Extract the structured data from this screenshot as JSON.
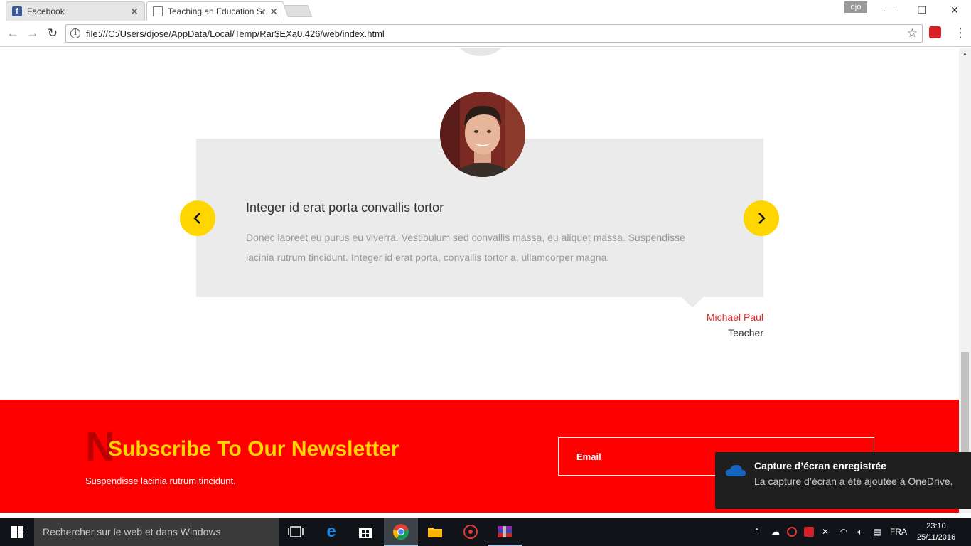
{
  "browser": {
    "tabs": [
      {
        "title": "Facebook",
        "icon": "facebook-icon"
      },
      {
        "title": "Teaching an Education Sc",
        "icon": "document-icon"
      }
    ],
    "profile_label": "djo",
    "url": "file:///C:/Users/djose/AppData/Local/Temp/Rar$EXa0.426/web/index.html"
  },
  "testimonial": {
    "heading": "Integer id erat porta convallis tortor",
    "body": "Donec laoreet eu purus eu viverra. Vestibulum sed convallis massa, eu aliquet massa. Suspendisse lacinia rutrum tincidunt. Integer id erat porta, convallis tortor a, ullamcorper magna.",
    "author_name": "Michael Paul",
    "author_role": "Teacher"
  },
  "newsletter": {
    "big_letter": "N",
    "title": "Subscribe To Our Newsletter",
    "subtitle": "Suspendisse lacinia rutrum tincidunt.",
    "email_placeholder": "Email"
  },
  "toast": {
    "title": "Capture d’écran enregistrée",
    "message": "La capture d’écran a été ajoutée à OneDrive."
  },
  "taskbar": {
    "search_placeholder": "Rechercher sur le web et dans Windows",
    "language": "FRA",
    "time": "23:10",
    "date": "25/11/2016"
  },
  "colors": {
    "accent_yellow": "#ffd600",
    "newsletter_red": "#ff0000",
    "author_red": "#e52b2b",
    "card_gray": "#ebebeb"
  }
}
